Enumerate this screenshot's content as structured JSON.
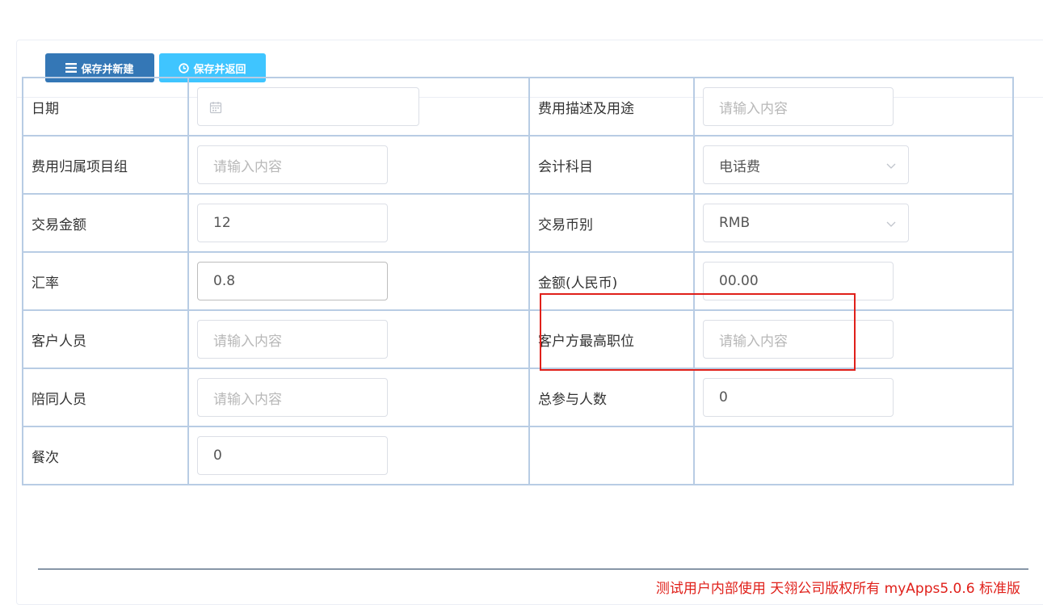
{
  "toolbar": {
    "save_new_label": "保存并新建",
    "save_return_label": "保存并返回",
    "save_new_icon": "list-icon",
    "save_return_icon": "clock-icon"
  },
  "form": {
    "date_label": "日期",
    "date_value": "",
    "purpose_label": "费用描述及用途",
    "purpose_placeholder": "请输入内容",
    "project_label": "费用归属项目组",
    "project_placeholder": "请输入内容",
    "account_label": "会计科目",
    "account_value": "电话费",
    "amount_label": "交易金额",
    "amount_value": "12",
    "currency_label": "交易币别",
    "currency_value": "RMB",
    "rate_label": "汇率",
    "rate_value": "0.8",
    "rmb_label": "金额(人民币)",
    "rmb_value": "00.00",
    "client_label": "客户人员",
    "client_placeholder": "请输入内容",
    "client_title_label": "客户方最高职位",
    "client_title_placeholder": "请输入内容",
    "escort_label": "陪同人员",
    "escort_placeholder": "请输入内容",
    "total_label": "总参与人数",
    "total_value": "0",
    "meals_label": "餐次",
    "meals_value": "0"
  },
  "footer": {
    "text": "测试用户内部使用 天翎公司版权所有 myApps5.0.6 标准版"
  },
  "colors": {
    "primary": "#3477b6",
    "info": "#3fc5ff",
    "highlight": "#e0201a",
    "table_border": "#b8cce4"
  }
}
